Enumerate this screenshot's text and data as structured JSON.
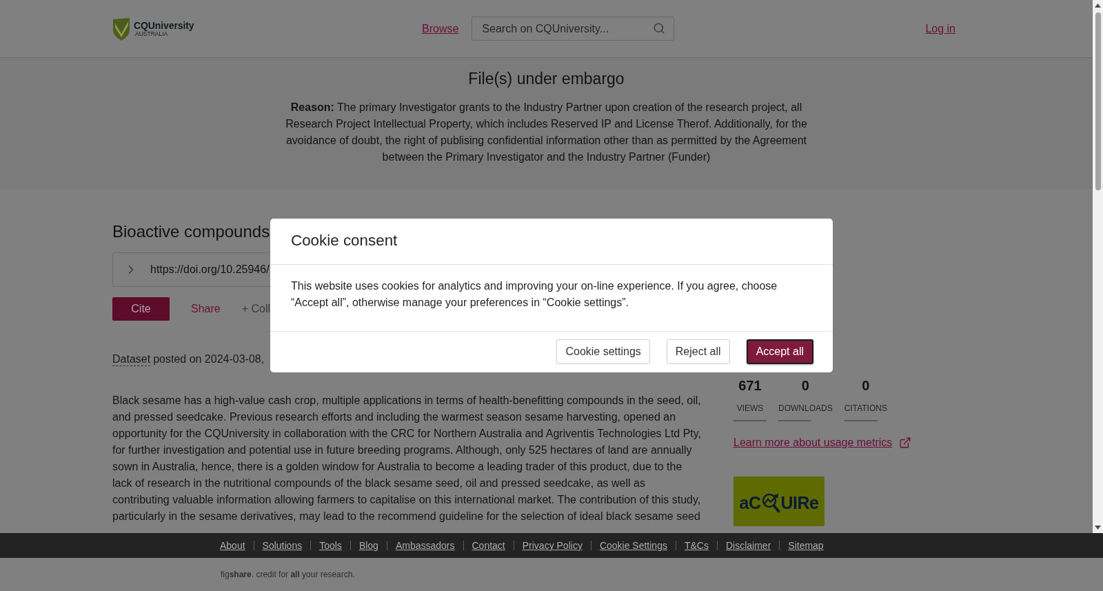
{
  "header": {
    "logo": {
      "name": "CQUniversity",
      "subtitle": "AUSTRALIA"
    },
    "browse_link": "Browse",
    "search": {
      "placeholder": "Search on CQUniversity..."
    },
    "login_link": "Log in"
  },
  "embargo": {
    "title": "File(s) under embargo",
    "reason": "**Reason:** The primary Investigator grants to the Industry Partner upon creation of the research project, all Research Project Intellectual Property, which includes Reserved IP and License Therof. Additionally, for the avoidance of doubt, the right of publising confidential information other than as permitted by the Agreement between the Primary Investigator and the Industry Partner (Funder)"
  },
  "item": {
    "title": "Bioactive compounds",
    "doi": "https://doi.org/10.25946/",
    "actions": [
      {
        "label": "Cite",
        "kind": "primary"
      },
      {
        "label": "Share",
        "kind": "link"
      },
      {
        "label": "+ Coll",
        "kind": "muted"
      }
    ],
    "item_type": "Dataset",
    "posted": "posted on 2024-03-08,",
    "description": "Black sesame has a high-value cash crop, multiple applications in terms of health-benefitting compounds in the seed, oil, and pressed seedcake. Previous research efforts and including the warmest season sesame harvesting, opened an opportunity for the CQUniversity in collaboration with the CRC for Northern Australia and Agriventis Technologies Ltd Pty, for further investigation and potential use in future breeding programs. Although, only 525 hectares of land are annually sown in Australia, hence, there is a golden window for Australia to become a leading trader of this product, due to the lack of research in the nutritional compounds of the black sesame seed, oil and pressed seedcake, as well as contributing valuable information allowing farmers to capitalise on this international market. The contribution of this study, particularly in the sesame derivatives, may lead to the recommend guideline for the selection of ideal black sesame seed"
  },
  "metrics": {
    "stats": [
      {
        "value": "671",
        "label": "VIEWS"
      },
      {
        "value": "0",
        "label": "DOWNLOADS"
      },
      {
        "value": "0",
        "label": "CITATIONS"
      }
    ],
    "learn_more": "Learn more about usage metrics"
  },
  "partner_logo": {
    "text_start": "aC",
    "text_end": "UIRe"
  },
  "footer": {
    "links": [
      "About",
      "Solutions",
      "Tools",
      "Blog",
      "Ambassadors",
      "Contact",
      "Privacy Policy",
      "Cookie Settings",
      "T&Cs",
      "Disclaimer",
      "Sitemap"
    ],
    "credit": "fig**share**. credit for **all** your research."
  },
  "cookie_dialog": {
    "title": "Cookie consent",
    "message": "This website uses cookies for analytics and improving your on-line experience. If you agree, choose “Accept all”, otherwise manage your preferences in “Cookie settings”.",
    "buttons": [
      {
        "label": "Cookie settings",
        "kind": "secondary",
        "focused": false
      },
      {
        "label": "Reject all",
        "kind": "secondary",
        "focused": false
      },
      {
        "label": "Accept all",
        "kind": "primary",
        "focused": true
      }
    ]
  }
}
